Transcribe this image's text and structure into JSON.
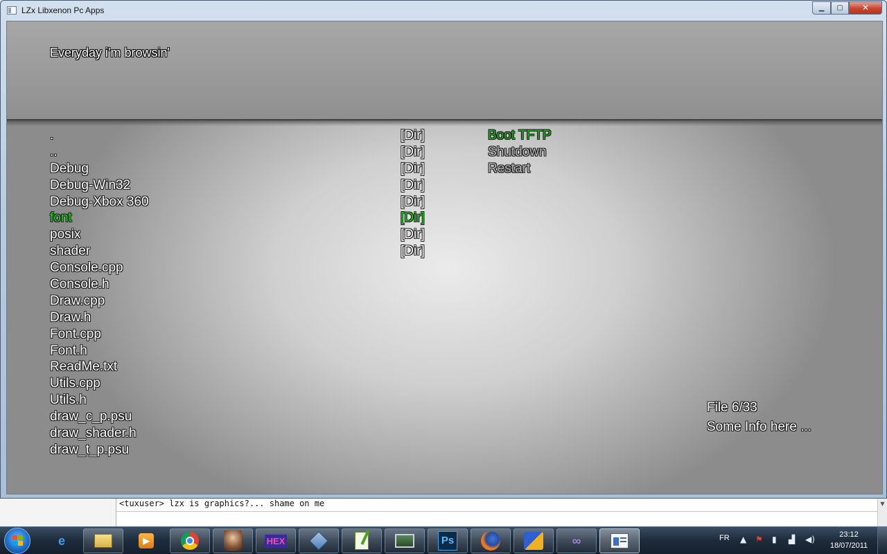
{
  "app": {
    "window_title": "LZx Libxenon Pc Apps",
    "header_title": "Everyday i'm browsin'"
  },
  "file_list": [
    {
      "name": ".",
      "tag": "[Dir]"
    },
    {
      "name": "..",
      "tag": "[Dir]"
    },
    {
      "name": "Debug",
      "tag": "[Dir]"
    },
    {
      "name": "Debug-Win32",
      "tag": "[Dir]"
    },
    {
      "name": "Debug-Xbox 360",
      "tag": "[Dir]"
    },
    {
      "name": "font",
      "tag": "[Dir]",
      "selected": true
    },
    {
      "name": "posix",
      "tag": "[Dir]"
    },
    {
      "name": "shader",
      "tag": "[Dir]"
    },
    {
      "name": "Console.cpp",
      "tag": ""
    },
    {
      "name": "Console.h",
      "tag": ""
    },
    {
      "name": "Draw.cpp",
      "tag": ""
    },
    {
      "name": "Draw.h",
      "tag": ""
    },
    {
      "name": "Font.cpp",
      "tag": ""
    },
    {
      "name": "Font.h",
      "tag": ""
    },
    {
      "name": "ReadMe.txt",
      "tag": ""
    },
    {
      "name": "Utils.cpp",
      "tag": ""
    },
    {
      "name": "Utils.h",
      "tag": ""
    },
    {
      "name": "draw_c_p.psu",
      "tag": ""
    },
    {
      "name": "draw_shader.h",
      "tag": ""
    },
    {
      "name": "draw_t_p.psu",
      "tag": ""
    }
  ],
  "menu": {
    "items": [
      "Boot TFTP",
      "Shutdown",
      "Restart"
    ]
  },
  "info": {
    "file_counter": "File 6/33",
    "details": "Some Info here ..."
  },
  "background_chat": {
    "line": "<tuxuser> lzx is graphics?... shame on me"
  },
  "taskbar": {
    "language": "FR",
    "time": "23:12",
    "date": "18/07/2011",
    "pinned": [
      "internet-explorer-icon",
      "explorer-icon",
      "media-player-icon",
      "chrome-icon",
      "portrait-app-icon",
      "hex-editor-icon",
      "virtualbox-icon",
      "notepad-icon",
      "remote-desktop-icon",
      "photoshop-icon",
      "firefox-icon",
      "paint-app-icon",
      "visual-studio-icon",
      "libxenon-app-icon"
    ],
    "photoshop_label": "Ps",
    "hex_label": "HEX"
  },
  "colors": {
    "selected": "#22cc22",
    "menu_active": "#22aa22",
    "menu_dim": "#b8b8b8"
  }
}
